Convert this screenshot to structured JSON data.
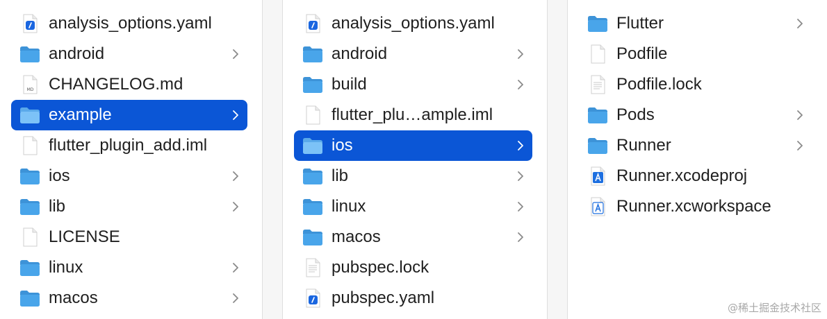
{
  "colors": {
    "selection": "#0b56d6",
    "folder": "#49a5ea",
    "text": "#1f1f1f"
  },
  "columns": [
    {
      "name": "column-root",
      "items": [
        {
          "label": "analysis_options.yaml",
          "icon": "yaml-file-icon",
          "chevron": false
        },
        {
          "label": "android",
          "icon": "folder-icon",
          "chevron": true
        },
        {
          "label": "CHANGELOG.md",
          "icon": "markdown-file-icon",
          "chevron": false
        },
        {
          "label": "example",
          "icon": "folder-icon",
          "chevron": true,
          "selected": true
        },
        {
          "label": "flutter_plugin_add.iml",
          "icon": "blank-file-icon",
          "chevron": false
        },
        {
          "label": "ios",
          "icon": "folder-icon",
          "chevron": true
        },
        {
          "label": "lib",
          "icon": "folder-icon",
          "chevron": true
        },
        {
          "label": "LICENSE",
          "icon": "blank-file-icon",
          "chevron": false
        },
        {
          "label": "linux",
          "icon": "folder-icon",
          "chevron": true
        },
        {
          "label": "macos",
          "icon": "folder-icon",
          "chevron": true
        }
      ]
    },
    {
      "name": "column-example",
      "items": [
        {
          "label": "analysis_options.yaml",
          "icon": "yaml-file-icon",
          "chevron": false
        },
        {
          "label": "android",
          "icon": "folder-icon",
          "chevron": true
        },
        {
          "label": "build",
          "icon": "folder-icon",
          "chevron": true
        },
        {
          "label": "flutter_plu…ample.iml",
          "icon": "blank-file-icon",
          "chevron": false
        },
        {
          "label": "ios",
          "icon": "folder-icon",
          "chevron": true,
          "selected": true
        },
        {
          "label": "lib",
          "icon": "folder-icon",
          "chevron": true
        },
        {
          "label": "linux",
          "icon": "folder-icon",
          "chevron": true
        },
        {
          "label": "macos",
          "icon": "folder-icon",
          "chevron": true
        },
        {
          "label": "pubspec.lock",
          "icon": "text-file-icon",
          "chevron": false
        },
        {
          "label": "pubspec.yaml",
          "icon": "yaml-file-icon",
          "chevron": false
        }
      ]
    },
    {
      "name": "column-ios",
      "items": [
        {
          "label": "Flutter",
          "icon": "folder-icon",
          "chevron": true
        },
        {
          "label": "Podfile",
          "icon": "blank-file-icon",
          "chevron": false
        },
        {
          "label": "Podfile.lock",
          "icon": "text-file-icon",
          "chevron": false
        },
        {
          "label": "Pods",
          "icon": "folder-icon",
          "chevron": true
        },
        {
          "label": "Runner",
          "icon": "folder-icon",
          "chevron": true
        },
        {
          "label": "Runner.xcodeproj",
          "icon": "xcodeproj-icon",
          "chevron": false
        },
        {
          "label": "Runner.xcworkspace",
          "icon": "xcworkspace-icon",
          "chevron": false
        }
      ]
    }
  ],
  "watermark": "@稀土掘金技术社区"
}
